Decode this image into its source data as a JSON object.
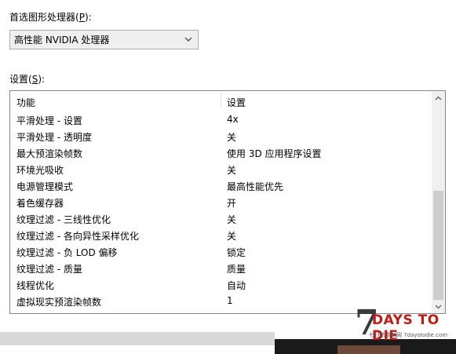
{
  "gpu_label": {
    "prefix": "首选图形处理器(",
    "mnemonic": "P",
    "suffix": "):"
  },
  "gpu_select": {
    "value": "高性能 NVIDIA 处理器"
  },
  "settings_label": {
    "prefix": "设置(",
    "mnemonic": "S",
    "suffix": "):"
  },
  "table": {
    "columns": [
      "功能",
      "设置"
    ],
    "rows": [
      [
        "平滑处理 - 设置",
        "4x"
      ],
      [
        "平滑处理 - 透明度",
        "关"
      ],
      [
        "最大预渲染帧数",
        "使用 3D 应用程序设置"
      ],
      [
        "环境光吸收",
        "关"
      ],
      [
        "电源管理模式",
        "最高性能优先"
      ],
      [
        "着色缓存器",
        "开"
      ],
      [
        "纹理过滤 - 三线性优化",
        "关"
      ],
      [
        "纹理过滤 - 各向异性采样优化",
        "关"
      ],
      [
        "纹理过滤 - 负 LOD 偏移",
        "锁定"
      ],
      [
        "纹理过滤 - 质量",
        "质量"
      ],
      [
        "线程优化",
        "自动"
      ],
      [
        "虚拟现实预渲染帧数",
        "1"
      ]
    ]
  },
  "scrollbar": {
    "position_fraction": 0.5,
    "visible_fraction": 0.56
  },
  "watermark": {
    "numeral": "7",
    "title": "DAYS TO DIE",
    "subtitle": "七日杀游戏网 7daystodie.com"
  },
  "colors": {
    "border": "#828790",
    "select_bg": "#efefef",
    "scroll_thumb": "#cdcdcd",
    "watermark_red": "#c11b17"
  },
  "icons": {
    "dropdown": "chevron-down-icon",
    "scroll_up": "arrow-up-icon",
    "scroll_down": "arrow-down-icon"
  }
}
